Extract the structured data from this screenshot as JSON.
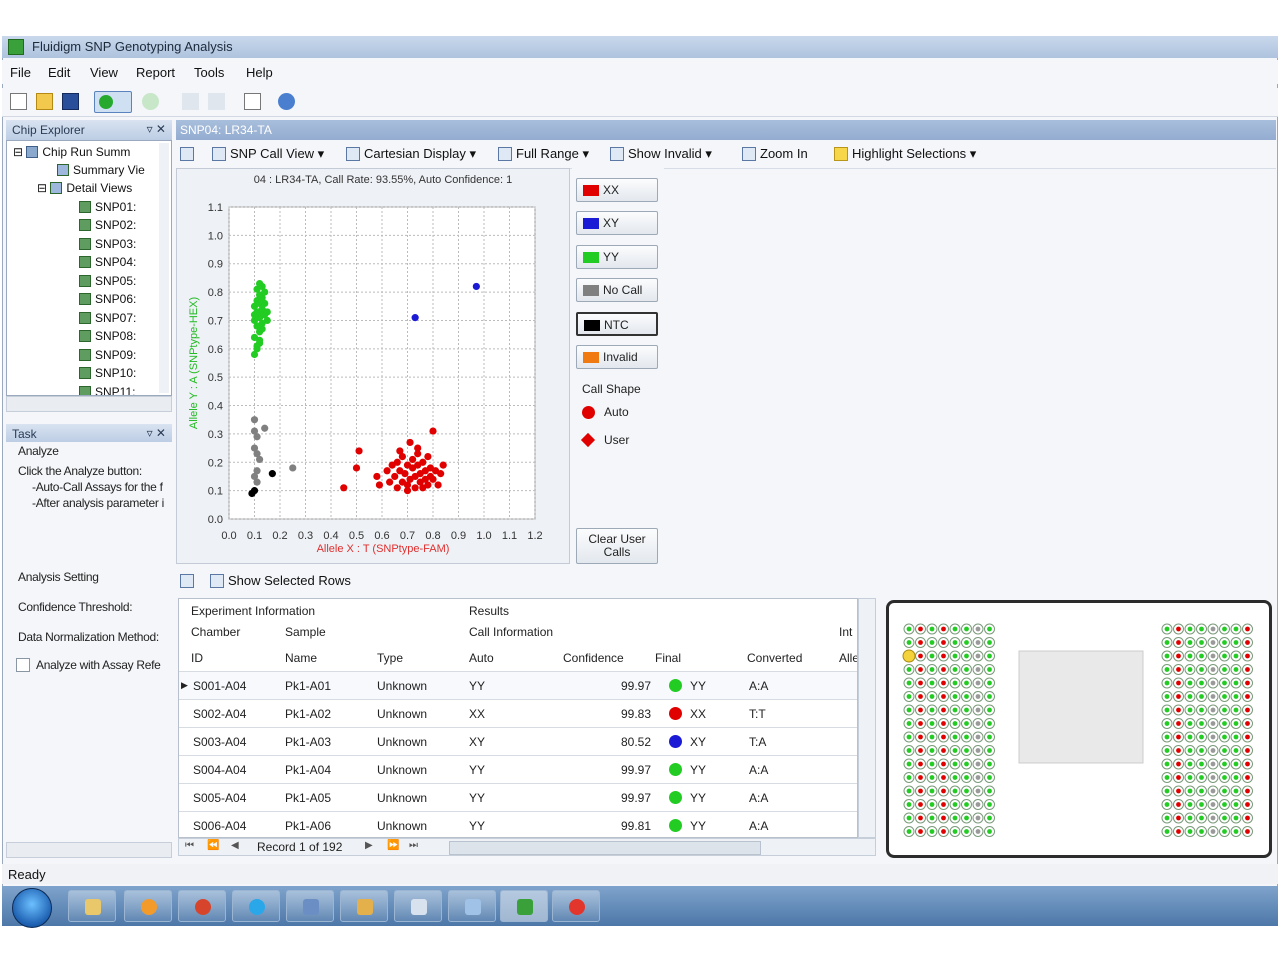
{
  "window": {
    "title": "Fluidigm SNP Genotyping Analysis"
  },
  "menu": [
    "File",
    "Edit",
    "View",
    "Report",
    "Tools",
    "Help"
  ],
  "chip_explorer": {
    "title": "Chip Explorer",
    "tree": [
      {
        "label": "Chip Run Summ"
      },
      {
        "label": "Summary Vie"
      },
      {
        "label": "Detail Views"
      },
      {
        "label": "SNP01:"
      },
      {
        "label": "SNP02:"
      },
      {
        "label": "SNP03:"
      },
      {
        "label": "SNP04:"
      },
      {
        "label": "SNP05:"
      },
      {
        "label": "SNP06:"
      },
      {
        "label": "SNP07:"
      },
      {
        "label": "SNP08:"
      },
      {
        "label": "SNP09:"
      },
      {
        "label": "SNP10:"
      },
      {
        "label": "SNP11:"
      }
    ]
  },
  "task": {
    "title": "Task",
    "heading": "Analyze",
    "lines": [
      "Click the Analyze button:",
      "-Auto-Call Assays for the f",
      "-After analysis parameter i"
    ],
    "analysis_setting": "Analysis Setting",
    "confidence_threshold": "Confidence Threshold:",
    "data_normalization": "Data Normalization Method:",
    "analyze_with": "Analyze with Assay Refe"
  },
  "doc_tab": "SNP04: LR34-TA",
  "view_toolbar": {
    "snp_call_view": "SNP Call View",
    "cartesian_display": "Cartesian Display",
    "full_range": "Full Range",
    "show_invalid": "Show Invalid",
    "zoom_in": "Zoom In",
    "highlight_selections": "Highlight Selections"
  },
  "legend": {
    "buttons": [
      {
        "label": "XX",
        "color": "#e00000"
      },
      {
        "label": "XY",
        "color": "#1b1bd6"
      },
      {
        "label": "YY",
        "color": "#22cc22"
      },
      {
        "label": "No Call",
        "color": "#808080"
      },
      {
        "label": "NTC",
        "color": "#000000"
      },
      {
        "label": "Invalid",
        "color": "#f07a10"
      }
    ],
    "call_shape": "Call Shape",
    "auto": "Auto",
    "user": "User",
    "clear_user_calls": "Clear User Calls"
  },
  "chart_data": {
    "type": "scatter",
    "title": "04 : LR34-TA, Call Rate: 93.55%, Auto Confidence: 1",
    "xlabel": "Allele X : T (SNPtype-FAM)",
    "ylabel": "Allele Y : A (SNPtype-HEX)",
    "xlim": [
      0.0,
      1.2
    ],
    "ylim": [
      0.0,
      1.1
    ],
    "xticks": [
      "0.0",
      "0.1",
      "0.2",
      "0.3",
      "0.4",
      "0.5",
      "0.6",
      "0.7",
      "0.8",
      "0.9",
      "1.0",
      "1.1",
      "1.2"
    ],
    "yticks": [
      "0.0",
      "0.1",
      "0.2",
      "0.3",
      "0.4",
      "0.5",
      "0.6",
      "0.7",
      "0.8",
      "0.9",
      "1.0",
      "1.1"
    ],
    "grid": true,
    "series": [
      {
        "name": "YY",
        "color": "#22cc22",
        "points": [
          [
            0.1,
            0.58
          ],
          [
            0.11,
            0.6
          ],
          [
            0.12,
            0.62
          ],
          [
            0.1,
            0.64
          ],
          [
            0.12,
            0.66
          ],
          [
            0.11,
            0.68
          ],
          [
            0.13,
            0.69
          ],
          [
            0.1,
            0.7
          ],
          [
            0.12,
            0.71
          ],
          [
            0.14,
            0.72
          ],
          [
            0.11,
            0.73
          ],
          [
            0.13,
            0.74
          ],
          [
            0.1,
            0.75
          ],
          [
            0.12,
            0.76
          ],
          [
            0.14,
            0.76
          ],
          [
            0.11,
            0.77
          ],
          [
            0.13,
            0.78
          ],
          [
            0.12,
            0.79
          ],
          [
            0.14,
            0.8
          ],
          [
            0.11,
            0.81
          ],
          [
            0.13,
            0.82
          ],
          [
            0.12,
            0.83
          ],
          [
            0.15,
            0.7
          ],
          [
            0.13,
            0.67
          ],
          [
            0.12,
            0.63
          ],
          [
            0.11,
            0.61
          ],
          [
            0.15,
            0.73
          ],
          [
            0.1,
            0.72
          ],
          [
            0.13,
            0.77
          ],
          [
            0.12,
            0.73
          ]
        ]
      },
      {
        "name": "XY",
        "color": "#1b1bd6",
        "points": [
          [
            0.73,
            0.71
          ],
          [
            0.97,
            0.82
          ]
        ]
      },
      {
        "name": "XX",
        "color": "#e00000",
        "points": [
          [
            0.45,
            0.11
          ],
          [
            0.5,
            0.18
          ],
          [
            0.51,
            0.24
          ],
          [
            0.58,
            0.15
          ],
          [
            0.59,
            0.12
          ],
          [
            0.62,
            0.17
          ],
          [
            0.63,
            0.13
          ],
          [
            0.64,
            0.19
          ],
          [
            0.65,
            0.15
          ],
          [
            0.66,
            0.11
          ],
          [
            0.66,
            0.2
          ],
          [
            0.67,
            0.17
          ],
          [
            0.68,
            0.13
          ],
          [
            0.68,
            0.22
          ],
          [
            0.69,
            0.16
          ],
          [
            0.7,
            0.19
          ],
          [
            0.7,
            0.12
          ],
          [
            0.71,
            0.14
          ],
          [
            0.71,
            0.27
          ],
          [
            0.72,
            0.18
          ],
          [
            0.72,
            0.21
          ],
          [
            0.73,
            0.15
          ],
          [
            0.73,
            0.11
          ],
          [
            0.74,
            0.19
          ],
          [
            0.74,
            0.23
          ],
          [
            0.75,
            0.13
          ],
          [
            0.75,
            0.16
          ],
          [
            0.76,
            0.2
          ],
          [
            0.76,
            0.11
          ],
          [
            0.77,
            0.17
          ],
          [
            0.77,
            0.14
          ],
          [
            0.78,
            0.22
          ],
          [
            0.78,
            0.12
          ],
          [
            0.79,
            0.18
          ],
          [
            0.79,
            0.15
          ],
          [
            0.8,
            0.31
          ],
          [
            0.8,
            0.14
          ],
          [
            0.81,
            0.17
          ],
          [
            0.82,
            0.12
          ],
          [
            0.83,
            0.16
          ],
          [
            0.84,
            0.19
          ],
          [
            0.67,
            0.24
          ],
          [
            0.7,
            0.1
          ],
          [
            0.74,
            0.25
          ]
        ]
      },
      {
        "name": "No Call",
        "color": "#808080",
        "points": [
          [
            0.1,
            0.35
          ],
          [
            0.1,
            0.31
          ],
          [
            0.11,
            0.29
          ],
          [
            0.1,
            0.25
          ],
          [
            0.11,
            0.23
          ],
          [
            0.12,
            0.21
          ],
          [
            0.11,
            0.17
          ],
          [
            0.1,
            0.15
          ],
          [
            0.14,
            0.32
          ],
          [
            0.25,
            0.18
          ],
          [
            0.11,
            0.13
          ]
        ]
      },
      {
        "name": "NTC",
        "color": "#000000",
        "points": [
          [
            0.1,
            0.1
          ],
          [
            0.09,
            0.09
          ],
          [
            0.17,
            0.16
          ]
        ]
      }
    ]
  },
  "grid_toolbar": {
    "show_selected_rows": "Show Selected Rows"
  },
  "table": {
    "group_headers": [
      "Experiment Information",
      "Results"
    ],
    "sub_headers": [
      "Chamber",
      "Sample",
      "Call Information",
      "Int"
    ],
    "columns": [
      "ID",
      "Name",
      "Type",
      "Auto",
      "Confidence",
      "Final",
      "Converted",
      "Alle"
    ],
    "rows": [
      {
        "id": "S001-A04",
        "name": "Pk1-A01",
        "type": "Unknown",
        "auto": "YY",
        "confidence": "99.97",
        "final": "YY",
        "final_color": "#22cc22",
        "converted": "A:A"
      },
      {
        "id": "S002-A04",
        "name": "Pk1-A02",
        "type": "Unknown",
        "auto": "XX",
        "confidence": "99.83",
        "final": "XX",
        "final_color": "#e00000",
        "converted": "T:T"
      },
      {
        "id": "S003-A04",
        "name": "Pk1-A03",
        "type": "Unknown",
        "auto": "XY",
        "confidence": "80.52",
        "final": "XY",
        "final_color": "#1b1bd6",
        "converted": "T:A"
      },
      {
        "id": "S004-A04",
        "name": "Pk1-A04",
        "type": "Unknown",
        "auto": "YY",
        "confidence": "99.97",
        "final": "YY",
        "final_color": "#22cc22",
        "converted": "A:A"
      },
      {
        "id": "S005-A04",
        "name": "Pk1-A05",
        "type": "Unknown",
        "auto": "YY",
        "confidence": "99.97",
        "final": "YY",
        "final_color": "#22cc22",
        "converted": "A:A"
      },
      {
        "id": "S006-A04",
        "name": "Pk1-A06",
        "type": "Unknown",
        "auto": "YY",
        "confidence": "99.81",
        "final": "YY",
        "final_color": "#22cc22",
        "converted": "A:A"
      }
    ],
    "record_text": "Record 1 of 192"
  },
  "status": "Ready"
}
